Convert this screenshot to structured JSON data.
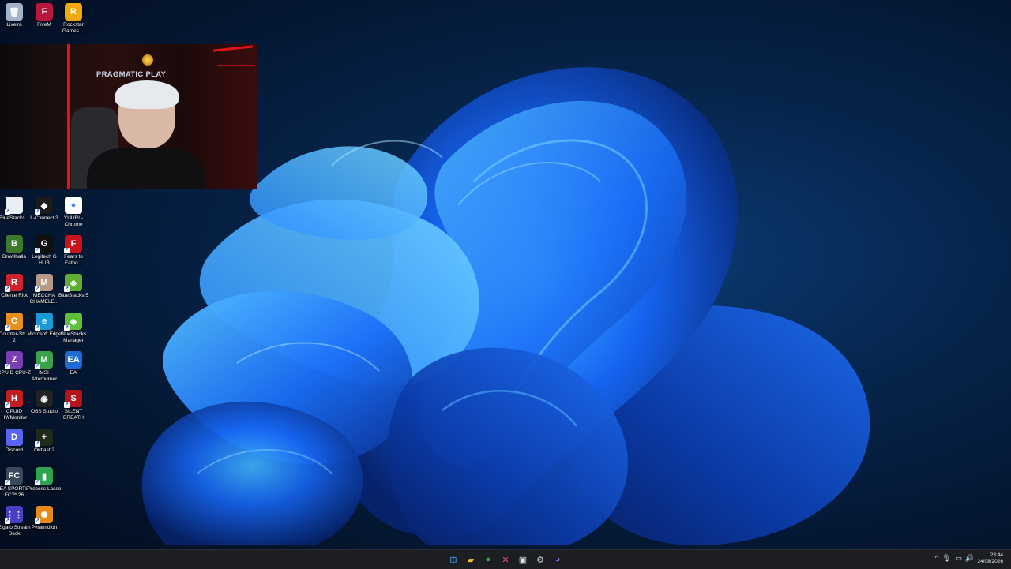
{
  "desktop": {
    "icons": [
      {
        "label": "Lixeira",
        "icon": "recycle-bin-icon",
        "color": "#9fb4c8",
        "glyph": "🗑"
      },
      {
        "label": "FiveM",
        "icon": "fivem-icon",
        "color": "#b8163a",
        "glyph": "F"
      },
      {
        "label": "Rockstar Games ...",
        "icon": "rockstar-icon",
        "color": "#f2a90c",
        "glyph": "R"
      },
      {
        "label": "BlueStacks...",
        "icon": "document-icon",
        "color": "#e9eef3",
        "glyph": ""
      },
      {
        "label": "L-Connect 3",
        "icon": "l-connect-icon",
        "color": "#1b1b1b",
        "glyph": "◆"
      },
      {
        "label": "YUURI - Chrome",
        "icon": "chrome-icon",
        "color": "#ffffff",
        "glyph": "●"
      },
      {
        "label": "Brawlhalla",
        "icon": "brawlhalla-icon",
        "color": "#3e7a2b",
        "glyph": "B"
      },
      {
        "label": "Logitech G HUB",
        "icon": "logitech-icon",
        "color": "#101010",
        "glyph": "G"
      },
      {
        "label": "Fears to Fatho...",
        "icon": "fears-icon",
        "color": "#c9141b",
        "glyph": "F"
      },
      {
        "label": "Cliente Riot",
        "icon": "riot-icon",
        "color": "#d0222c",
        "glyph": "R"
      },
      {
        "label": "MECCHA CHAMELE...",
        "icon": "meccha-icon",
        "color": "#b79a86",
        "glyph": "M"
      },
      {
        "label": "BlueStacks 5",
        "icon": "bluestacks-icon",
        "color": "#5cae34",
        "glyph": "◈"
      },
      {
        "label": "Counter-Str... 2",
        "icon": "counter-strike-icon",
        "color": "#e6901d",
        "glyph": "C"
      },
      {
        "label": "Microsoft Edge",
        "icon": "edge-icon",
        "color": "#1a9ad6",
        "glyph": "e"
      },
      {
        "label": "BlueStacks Manager",
        "icon": "bluestacks-manager-icon",
        "color": "#5fbf3a",
        "glyph": "◈"
      },
      {
        "label": "CPUID CPU-Z",
        "icon": "cpuz-icon",
        "color": "#7b3fb3",
        "glyph": "Z"
      },
      {
        "label": "MSI Afterburner",
        "icon": "afterburner-icon",
        "color": "#3aa34a",
        "glyph": "M"
      },
      {
        "label": "EA",
        "icon": "ea-icon",
        "color": "#1e6ad2",
        "glyph": "EA"
      },
      {
        "label": "CPUID HWMonitor",
        "icon": "hwmonitor-icon",
        "color": "#c11f1f",
        "glyph": "H"
      },
      {
        "label": "OBS Studio",
        "icon": "obs-icon",
        "color": "#222222",
        "glyph": "◉"
      },
      {
        "label": "SILENT BREATH",
        "icon": "silent-breath-icon",
        "color": "#b5141a",
        "glyph": "S"
      },
      {
        "label": "Discord",
        "icon": "discord-icon",
        "color": "#5865f2",
        "glyph": "D"
      },
      {
        "label": "Outlast 2",
        "icon": "outlast-icon",
        "color": "#1f2a1a",
        "glyph": "+"
      },
      {
        "label": "EA SPORTS FC™ 26",
        "icon": "ea-sports-fc-icon",
        "color": "#3a4a5c",
        "glyph": "FC"
      },
      {
        "label": "Process Lasso",
        "icon": "process-lasso-icon",
        "color": "#2ea44f",
        "glyph": "▮"
      },
      {
        "label": "Elgato Stream Deck",
        "icon": "stream-deck-icon",
        "color": "#4a3fc2",
        "glyph": "⋮⋮"
      },
      {
        "label": "Pyramidion",
        "icon": "pyramidion-icon",
        "color": "#e8891a",
        "glyph": "✺"
      }
    ]
  },
  "webcam": {
    "logo_text": "PRAGMATIC PLAY"
  },
  "taskbar": {
    "apps": [
      {
        "name": "start",
        "icon": "windows-start-icon",
        "glyph": "⊞",
        "color": "#3ea3ff"
      },
      {
        "name": "file-explorer",
        "icon": "folder-icon",
        "glyph": "▰",
        "color": "#f2c13c"
      },
      {
        "name": "chrome",
        "icon": "chrome-icon",
        "glyph": "●",
        "color": "#2fa84f"
      },
      {
        "name": "app-x",
        "icon": "x-app-icon",
        "glyph": "✕",
        "color": "#e44c9a"
      },
      {
        "name": "app-window",
        "icon": "window-app-icon",
        "glyph": "▣",
        "color": "#dfe6ef"
      },
      {
        "name": "app-gear",
        "icon": "steam-icon",
        "glyph": "⚙",
        "color": "#c9ced6"
      },
      {
        "name": "app-chat",
        "icon": "chat-app-icon",
        "glyph": "◕",
        "color": "#9b6df2"
      }
    ],
    "tray": {
      "chevron": "^",
      "clock_time": "23:44",
      "clock_date": "24/08/2026"
    }
  },
  "colors": {
    "taskbar_bg": "#1c1e22",
    "wallpaper_blue": "#1560ff"
  }
}
